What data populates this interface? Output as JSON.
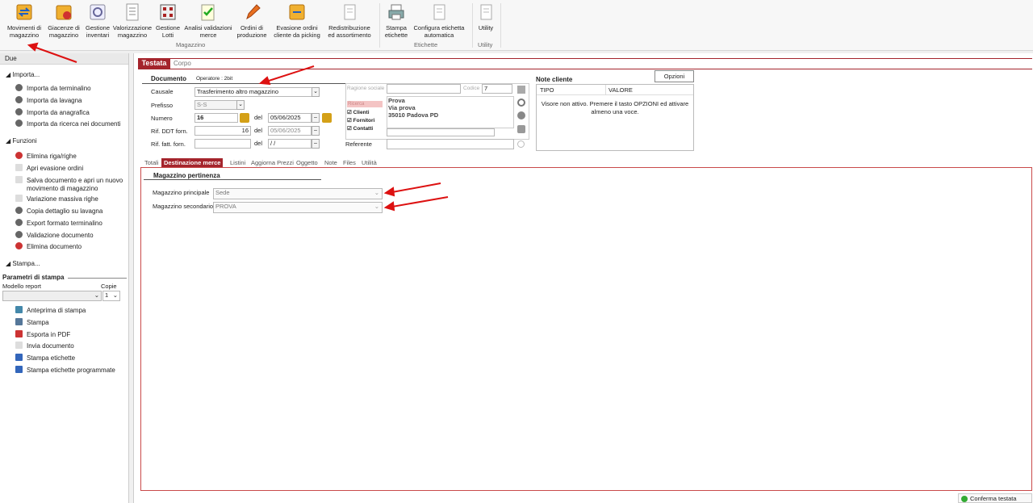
{
  "ribbon": {
    "buttons": [
      {
        "label": "Movimenti di magazzino",
        "icon": "box-arrows-icon"
      },
      {
        "label": "Giacenze di magazzino",
        "icon": "box-stock-icon"
      },
      {
        "label": "Gestione inventari",
        "icon": "inventory-icon"
      },
      {
        "label": "Valorizzazione magazzino",
        "icon": "document-list-icon"
      },
      {
        "label": "Gestione Lotti",
        "icon": "barcode-grid-icon"
      },
      {
        "label": "Analisi validazioni merce",
        "icon": "checklist-icon"
      },
      {
        "label": "Ordini di produzione",
        "icon": "pencil-icon"
      },
      {
        "label": "Evasione ordini cliente da picking",
        "icon": "box-picking-icon"
      },
      {
        "label": "Redistribuzione ed assortimento",
        "icon": "document-icon"
      },
      {
        "label": "Stampa etichette",
        "icon": "printer-icon"
      },
      {
        "label": "Configura etichetta automatica",
        "icon": "document-icon"
      },
      {
        "label": "Utility",
        "icon": "document-icon"
      }
    ],
    "groups": {
      "magazzino": "Magazzino",
      "etichette": "Etichette",
      "utility": "Utility"
    }
  },
  "sidebar": {
    "header": "Due",
    "sections": {
      "importa": "Importa...",
      "funzioni": "Funzioni",
      "stampa": "Stampa..."
    },
    "importa_items": [
      "Importa da terminalino",
      "Importa da lavagna",
      "Importa da anagrafica",
      "Importa da ricerca nei documenti"
    ],
    "funzioni_items": [
      "Elimina riga/righe",
      "Apri evasione ordini",
      "Salva documento e apri un nuovo",
      "movimento di magazzino",
      "Variazione massiva righe",
      "Copia dettaglio su lavagna",
      "Export formato terminalino",
      "Validazione documento",
      "Elimina documento"
    ],
    "print_params": {
      "title": "Parametri di stampa",
      "modello_label": "Modello report",
      "copie_label": "Copie",
      "copie_value": "1"
    },
    "stampa_items": [
      "Anteprima di stampa",
      "Stampa",
      "Esporta in PDF",
      "Invia documento",
      "Stampa etichette",
      "Stampa etichette programmate"
    ]
  },
  "tabs": {
    "testata": "Testata",
    "corpo": "Corpo"
  },
  "documento": {
    "title": "Documento",
    "operatore": "Operatore : 2bit",
    "causale_label": "Causale",
    "causale_value": "Trasferimento altro magazzino",
    "prefisso_label": "Prefisso",
    "prefisso_value": "S-S",
    "numero_label": "Numero",
    "numero_value": "16",
    "del_label": "del",
    "numero_date": "05/06/2025",
    "ddt_label": "Rif. DDT forn.",
    "ddt_value": "16",
    "ddt_date": "05/06/2025",
    "fatt_label": "Rif. fatt. forn.",
    "fatt_date": " / /"
  },
  "anagrafica": {
    "ragione_label": "Ragione sociale",
    "codice_label": "Codice",
    "codice_value": "7",
    "ricerca_label": "Ricerca",
    "checks": [
      "Clienti",
      "Fornitori",
      "Contatti"
    ],
    "address": [
      "Prova",
      "Via prova",
      "35010 Padova  PD"
    ],
    "referente_label": "Referente"
  },
  "note_cliente": {
    "title": "Note cliente",
    "opzioni": "Opzioni",
    "col_tipo": "TIPO",
    "col_valore": "VALORE",
    "message": "Visore non attivo. Premere il tasto OPZIONI ed attivare almeno una voce."
  },
  "subtabs": [
    "Totali",
    "Destinazione merce",
    "Listini",
    "Aggiorna Prezzi",
    "Oggetto",
    "Note",
    "Files",
    "Utilità"
  ],
  "destinazione": {
    "title": "Magazzino pertinenza",
    "principale_label": "Magazzino principale",
    "principale_value": "Sede",
    "secondario_label": "Magazzino secondario",
    "secondario_value": "PROVA"
  },
  "footer": {
    "confirm": "Conferma testata"
  },
  "colors": {
    "accent": "#a4242c",
    "annotation_arrow": "#dd1111"
  }
}
